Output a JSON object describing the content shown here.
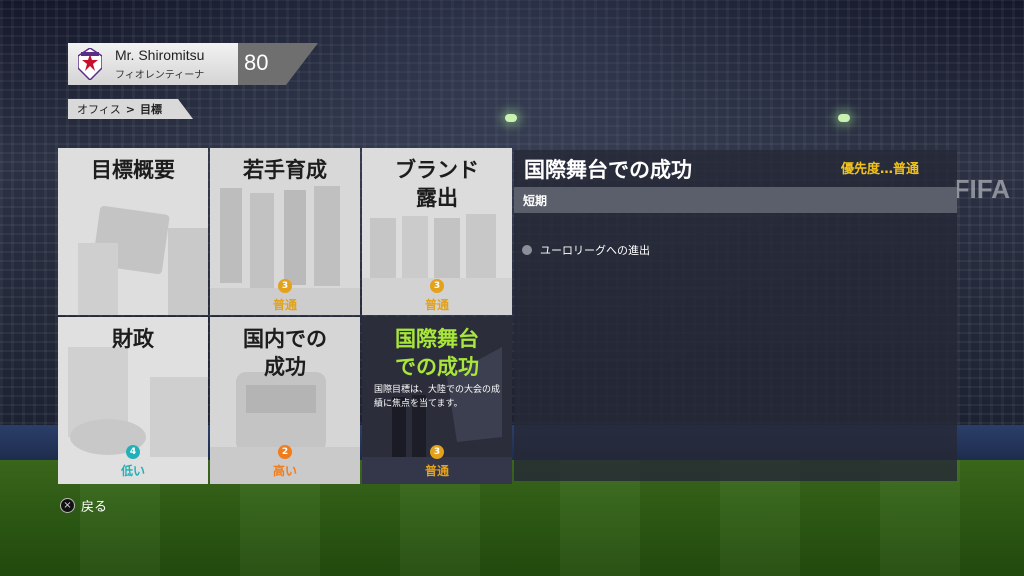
{
  "profile": {
    "manager_name": "Mr. Shiromitsu",
    "club_name": "フィオレンティーナ",
    "rating": "80"
  },
  "breadcrumb": {
    "parent": "オフィス",
    "current": "目標"
  },
  "tiles": [
    {
      "title": "目標概要",
      "priority_level": null,
      "priority_label": null
    },
    {
      "title": "若手育成",
      "priority_level": "3",
      "priority_label": "普通",
      "priority_color": "#e3a21a"
    },
    {
      "title": "ブランド露出",
      "title_lines": [
        "ブランド",
        "露出"
      ],
      "priority_level": "3",
      "priority_label": "普通",
      "priority_color": "#e3a21a"
    },
    {
      "title": "財政",
      "priority_level": "4",
      "priority_label": "低い",
      "priority_color": "#24b0b8"
    },
    {
      "title": "国内での成功",
      "title_lines": [
        "国内での",
        "成功"
      ],
      "priority_level": "2",
      "priority_label": "高い",
      "priority_color": "#f07d1c"
    },
    {
      "title": "国際舞台での成功",
      "title_lines": [
        "国際舞台",
        "での成功"
      ],
      "description": "国際目標は、大陸での大会の成績に焦点を当てます。",
      "priority_level": "3",
      "priority_label": "普通",
      "priority_color": "#e3a21a",
      "selected": true
    }
  ],
  "panel": {
    "title": "国際舞台での成功",
    "priority": "優先度…普通",
    "section_label": "短期",
    "goals": [
      "ユーロリーグへの進出"
    ]
  },
  "footer": {
    "back_icon": "×",
    "back_label": "戻る"
  },
  "colors": {
    "selected_title": "#a8e63a",
    "priority_text": "#f1c21b"
  },
  "background": {
    "logo_text": "FIFA"
  }
}
